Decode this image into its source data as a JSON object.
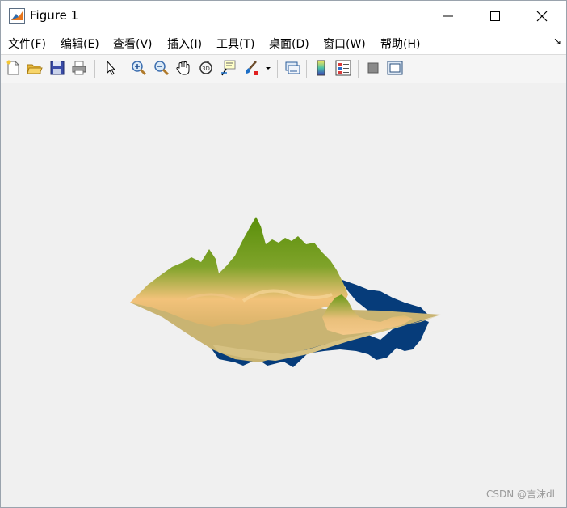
{
  "window": {
    "title": "Figure 1"
  },
  "menu": {
    "items": [
      {
        "label": "文件(F)"
      },
      {
        "label": "编辑(E)"
      },
      {
        "label": "查看(V)"
      },
      {
        "label": "插入(I)"
      },
      {
        "label": "工具(T)"
      },
      {
        "label": "桌面(D)"
      },
      {
        "label": "窗口(W)"
      },
      {
        "label": "帮助(H)"
      }
    ],
    "dock_arrow": "↘"
  },
  "toolbar": {
    "icons": [
      "new-figure-icon",
      "open-file-icon",
      "save-icon",
      "print-icon",
      "edit-plot-icon",
      "zoom-in-icon",
      "zoom-out-icon",
      "pan-icon",
      "rotate-3d-icon",
      "data-cursor-icon",
      "brush-icon",
      "link-plot-icon",
      "colorbar-icon",
      "legend-icon",
      "hide-plot-tools-icon",
      "show-plot-tools-icon"
    ]
  },
  "plot": {
    "surface_colors": {
      "peak": "#5a8f0a",
      "mid": "#f2c27a",
      "plane": "#c9b472",
      "underside": "#063c7a"
    }
  },
  "watermark": "CSDN @言沫dl"
}
